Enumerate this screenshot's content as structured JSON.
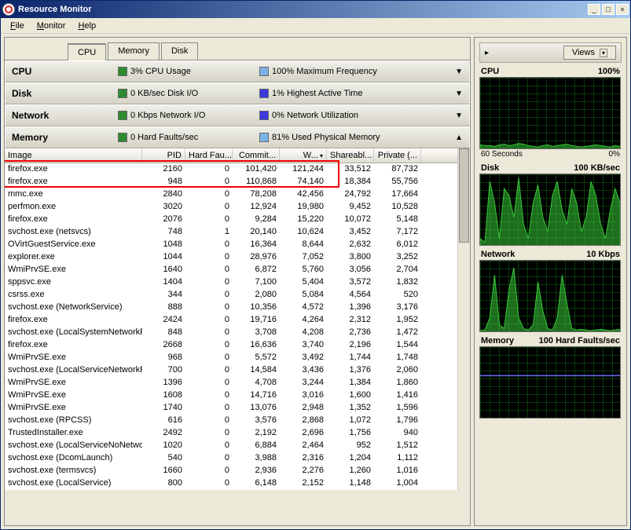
{
  "window": {
    "title": "Resource Monitor"
  },
  "menu": {
    "file": "File",
    "monitor": "Monitor",
    "help": "Help"
  },
  "tabs": {
    "cpu": "CPU",
    "memory": "Memory",
    "disk": "Disk"
  },
  "sections": {
    "cpu": {
      "title": "CPU",
      "stat1": "3% CPU Usage",
      "stat2": "100% Maximum Frequency",
      "color1": "#2e8b2e",
      "color2": "#7bb3e8"
    },
    "disk": {
      "title": "Disk",
      "stat1": "0 KB/sec Disk I/O",
      "stat2": "1% Highest Active Time",
      "color1": "#2e8b2e",
      "color2": "#3a3ae0"
    },
    "network": {
      "title": "Network",
      "stat1": "0 Kbps Network I/O",
      "stat2": "0% Network Utilization",
      "color1": "#2e8b2e",
      "color2": "#3a3ae0"
    },
    "memory": {
      "title": "Memory",
      "stat1": "0 Hard Faults/sec",
      "stat2": "81% Used Physical Memory",
      "color1": "#2e8b2e",
      "color2": "#7bb3e8"
    }
  },
  "columns": {
    "image": "Image",
    "pid": "PID",
    "hardfaults": "Hard Fau...",
    "commit": "Commit...",
    "working": "W...",
    "shareable": "Shareabl...",
    "private": "Private (..."
  },
  "processes": [
    {
      "image": "firefox.exe",
      "pid": "2160",
      "hf": "0",
      "commit": "101,420",
      "ws": "121,244",
      "sh": "33,512",
      "pv": "87,732"
    },
    {
      "image": "firefox.exe",
      "pid": "948",
      "hf": "0",
      "commit": "110,868",
      "ws": "74,140",
      "sh": "18,384",
      "pv": "55,756"
    },
    {
      "image": "mmc.exe",
      "pid": "2840",
      "hf": "0",
      "commit": "78,208",
      "ws": "42,456",
      "sh": "24,792",
      "pv": "17,664"
    },
    {
      "image": "perfmon.exe",
      "pid": "3020",
      "hf": "0",
      "commit": "12,924",
      "ws": "19,980",
      "sh": "9,452",
      "pv": "10,528"
    },
    {
      "image": "firefox.exe",
      "pid": "2076",
      "hf": "0",
      "commit": "9,284",
      "ws": "15,220",
      "sh": "10,072",
      "pv": "5,148"
    },
    {
      "image": "svchost.exe (netsvcs)",
      "pid": "748",
      "hf": "1",
      "commit": "20,140",
      "ws": "10,624",
      "sh": "3,452",
      "pv": "7,172"
    },
    {
      "image": "OVirtGuestService.exe",
      "pid": "1048",
      "hf": "0",
      "commit": "16,364",
      "ws": "8,644",
      "sh": "2,632",
      "pv": "6,012"
    },
    {
      "image": "explorer.exe",
      "pid": "1044",
      "hf": "0",
      "commit": "28,976",
      "ws": "7,052",
      "sh": "3,800",
      "pv": "3,252"
    },
    {
      "image": "WmiPrvSE.exe",
      "pid": "1640",
      "hf": "0",
      "commit": "6,872",
      "ws": "5,760",
      "sh": "3,056",
      "pv": "2,704"
    },
    {
      "image": "sppsvc.exe",
      "pid": "1404",
      "hf": "0",
      "commit": "7,100",
      "ws": "5,404",
      "sh": "3,572",
      "pv": "1,832"
    },
    {
      "image": "csrss.exe",
      "pid": "344",
      "hf": "0",
      "commit": "2,080",
      "ws": "5,084",
      "sh": "4,564",
      "pv": "520"
    },
    {
      "image": "svchost.exe (NetworkService)",
      "pid": "888",
      "hf": "0",
      "commit": "10,356",
      "ws": "4,572",
      "sh": "1,396",
      "pv": "3,176"
    },
    {
      "image": "firefox.exe",
      "pid": "2424",
      "hf": "0",
      "commit": "19,716",
      "ws": "4,264",
      "sh": "2,312",
      "pv": "1,952"
    },
    {
      "image": "svchost.exe (LocalSystemNetworkR...",
      "pid": "848",
      "hf": "0",
      "commit": "3,708",
      "ws": "4,208",
      "sh": "2,736",
      "pv": "1,472"
    },
    {
      "image": "firefox.exe",
      "pid": "2668",
      "hf": "0",
      "commit": "16,636",
      "ws": "3,740",
      "sh": "2,196",
      "pv": "1,544"
    },
    {
      "image": "WmiPrvSE.exe",
      "pid": "968",
      "hf": "0",
      "commit": "5,572",
      "ws": "3,492",
      "sh": "1,744",
      "pv": "1,748"
    },
    {
      "image": "svchost.exe (LocalServiceNetworkR...",
      "pid": "700",
      "hf": "0",
      "commit": "14,584",
      "ws": "3,436",
      "sh": "1,376",
      "pv": "2,060"
    },
    {
      "image": "WmiPrvSE.exe",
      "pid": "1396",
      "hf": "0",
      "commit": "4,708",
      "ws": "3,244",
      "sh": "1,384",
      "pv": "1,860"
    },
    {
      "image": "WmiPrvSE.exe",
      "pid": "1608",
      "hf": "0",
      "commit": "14,716",
      "ws": "3,016",
      "sh": "1,600",
      "pv": "1,416"
    },
    {
      "image": "WmiPrvSE.exe",
      "pid": "1740",
      "hf": "0",
      "commit": "13,076",
      "ws": "2,948",
      "sh": "1,352",
      "pv": "1,596"
    },
    {
      "image": "svchost.exe (RPCSS)",
      "pid": "616",
      "hf": "0",
      "commit": "3,576",
      "ws": "2,868",
      "sh": "1,072",
      "pv": "1,796"
    },
    {
      "image": "TrustedInstaller.exe",
      "pid": "2492",
      "hf": "0",
      "commit": "2,192",
      "ws": "2,696",
      "sh": "1,756",
      "pv": "940"
    },
    {
      "image": "svchost.exe (LocalServiceNoNetwork)",
      "pid": "1020",
      "hf": "0",
      "commit": "6,884",
      "ws": "2,464",
      "sh": "952",
      "pv": "1,512"
    },
    {
      "image": "svchost.exe (DcomLaunch)",
      "pid": "540",
      "hf": "0",
      "commit": "3,988",
      "ws": "2,316",
      "sh": "1,204",
      "pv": "1,112"
    },
    {
      "image": "svchost.exe (termsvcs)",
      "pid": "1660",
      "hf": "0",
      "commit": "2,936",
      "ws": "2,276",
      "sh": "1,260",
      "pv": "1,016"
    },
    {
      "image": "svchost.exe (LocalService)",
      "pid": "800",
      "hf": "0",
      "commit": "6,148",
      "ws": "2,152",
      "sh": "1,148",
      "pv": "1,004"
    }
  ],
  "charts": {
    "cpu": {
      "title": "CPU",
      "right": "100%",
      "footer_left": "60 Seconds",
      "footer_right": "0%"
    },
    "disk": {
      "title": "Disk",
      "right": "100 KB/sec"
    },
    "network": {
      "title": "Network",
      "right": "10 Kbps"
    },
    "memory": {
      "title": "Memory",
      "right": "100 Hard Faults/sec"
    }
  },
  "views": {
    "label": "Views",
    "arrow": "▸"
  },
  "chart_data": [
    {
      "type": "area",
      "label": "CPU",
      "ylim": [
        0,
        100
      ],
      "series": [
        {
          "name": "usage",
          "color": "#37c837",
          "values": [
            6,
            5,
            5,
            4,
            6,
            7,
            5,
            6,
            8,
            7,
            5,
            4,
            3,
            5,
            6,
            4,
            5,
            6,
            7,
            5,
            4,
            3,
            4,
            5,
            6,
            5,
            4,
            3,
            5,
            4
          ]
        }
      ]
    },
    {
      "type": "area",
      "label": "Disk",
      "ylim": [
        0,
        100
      ],
      "series": [
        {
          "name": "io",
          "color": "#37c837",
          "values": [
            10,
            5,
            90,
            60,
            10,
            80,
            70,
            40,
            95,
            30,
            10,
            60,
            85,
            40,
            20,
            70,
            90,
            50,
            30,
            80,
            60,
            20,
            40,
            90,
            70,
            30,
            10,
            50,
            80,
            60
          ]
        }
      ]
    },
    {
      "type": "area",
      "label": "Network",
      "ylim": [
        0,
        10
      ],
      "series": [
        {
          "name": "kbps",
          "color": "#37c837",
          "values": [
            0.2,
            0.3,
            2,
            8,
            1,
            0.5,
            6,
            9,
            2,
            0.5,
            0.3,
            1,
            7,
            3,
            0.5,
            0.3,
            2,
            8,
            4,
            0.5,
            0.3,
            0.4,
            0.3,
            0.2,
            0.3,
            0.4,
            0.3,
            0.2,
            0.3,
            0.4
          ]
        }
      ]
    },
    {
      "type": "line",
      "label": "Memory",
      "ylim": [
        0,
        100
      ],
      "series": [
        {
          "name": "hardfaults",
          "color": "#6a6af0",
          "values": [
            60,
            60,
            60,
            60,
            60,
            60,
            60,
            60,
            60,
            60,
            60,
            60,
            60,
            60,
            60,
            60,
            60,
            60,
            60,
            60,
            60,
            60,
            60,
            60,
            60,
            60,
            60,
            60,
            60,
            60
          ]
        }
      ]
    }
  ]
}
